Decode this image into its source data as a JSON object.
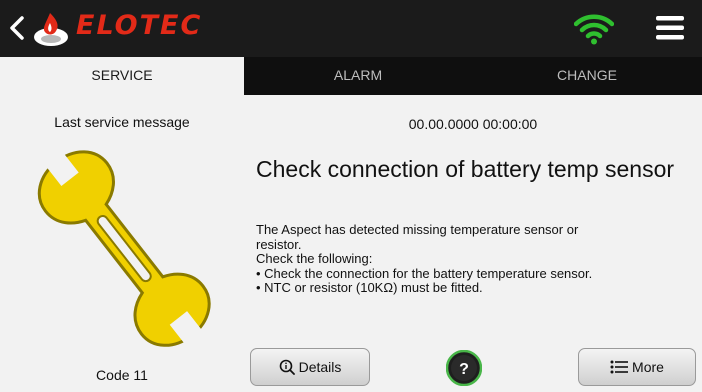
{
  "header": {
    "brand": "ELOTEC",
    "back_icon": "chevron-left-icon",
    "status_icon": "wifi-icon",
    "menu_icon": "hamburger-menu-icon",
    "colors": {
      "bar": "#1b1b1b",
      "brand_red": "#e22a18",
      "wifi_green": "#2fbf2f"
    }
  },
  "tabs": [
    {
      "label": "SERVICE",
      "active": true
    },
    {
      "label": "ALARM",
      "active": false
    },
    {
      "label": "CHANGE",
      "active": false
    }
  ],
  "left_panel": {
    "label": "Last service message",
    "icon": "wrench-icon",
    "code": "Code 11"
  },
  "message": {
    "timestamp": "00.00.0000 00:00:00",
    "title": "Check connection of battery temp sensor",
    "body_lines": [
      "The Aspect has detected missing temperature sensor or",
      "resistor.",
      "Check the following:",
      "• Check the connection for the battery temperature sensor.",
      "• NTC or resistor (10KΩ) must be fitted."
    ]
  },
  "buttons": {
    "details": "Details",
    "help_glyph": "?",
    "more": "More"
  }
}
